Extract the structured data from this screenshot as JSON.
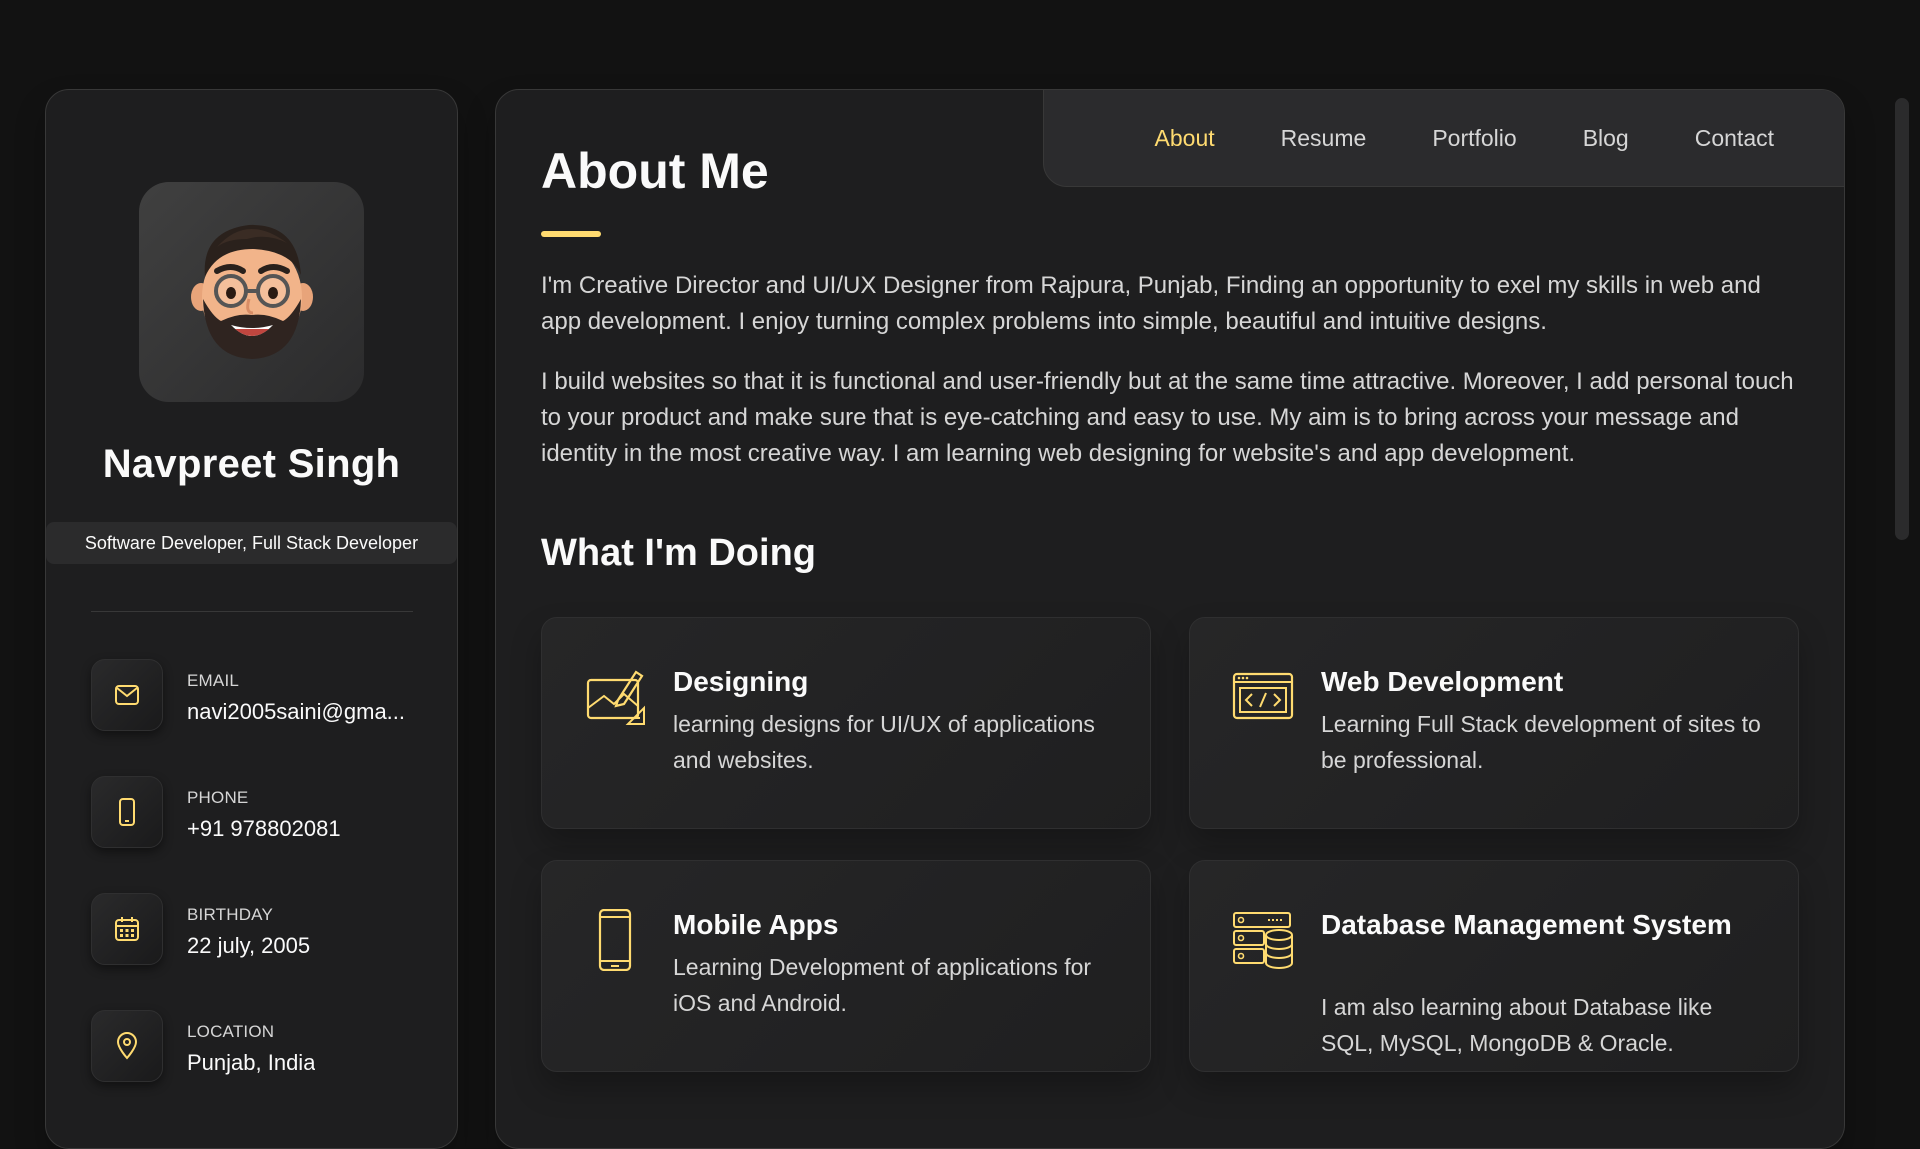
{
  "sidebar": {
    "name": "Navpreet Singh",
    "title": "Software Developer, Full Stack Developer",
    "contacts": [
      {
        "label": "Email",
        "value": "navi2005saini@gma...",
        "icon": "mail-icon"
      },
      {
        "label": "Phone",
        "value": "+91 978802081",
        "icon": "phone-icon"
      },
      {
        "label": "Birthday",
        "value": "22 july, 2005",
        "icon": "calendar-icon"
      },
      {
        "label": "Location",
        "value": "Punjab, India",
        "icon": "location-pin-icon"
      }
    ]
  },
  "nav": {
    "items": [
      "About",
      "Resume",
      "Portfolio",
      "Blog",
      "Contact"
    ],
    "active": "About"
  },
  "about": {
    "title": "About Me",
    "paragraphs": [
      "I'm Creative Director and UI/UX Designer from Rajpura, Punjab, Finding an opportunity to exel my skills in web and app development. I enjoy turning complex problems into simple, beautiful and intuitive designs.",
      "I build websites so that it is functional and user-friendly but at the same time attractive. Moreover, I add personal touch to your product and make sure that is eye-catching and easy to use. My aim is to bring across your message and identity in the most creative way. I am learning web designing for website's and app development."
    ]
  },
  "services": {
    "title": "What I'm Doing",
    "items": [
      {
        "title": "Designing",
        "text": "learning designs for UI/UX of applications and websites.",
        "icon": "design-icon"
      },
      {
        "title": "Web Development",
        "text": "Learning Full Stack development of sites to be professional.",
        "icon": "code-window-icon"
      },
      {
        "title": "Mobile Apps",
        "text": "Learning Development of applications for iOS and Android.",
        "icon": "mobile-icon"
      },
      {
        "title": "Database Management System",
        "text": "I am also learning about Database like SQL, MySQL, MongoDB & Oracle.",
        "icon": "database-icon"
      }
    ]
  },
  "colors": {
    "accent": "#ffdb70",
    "background": "#121212",
    "card": "#1e1e1f"
  }
}
